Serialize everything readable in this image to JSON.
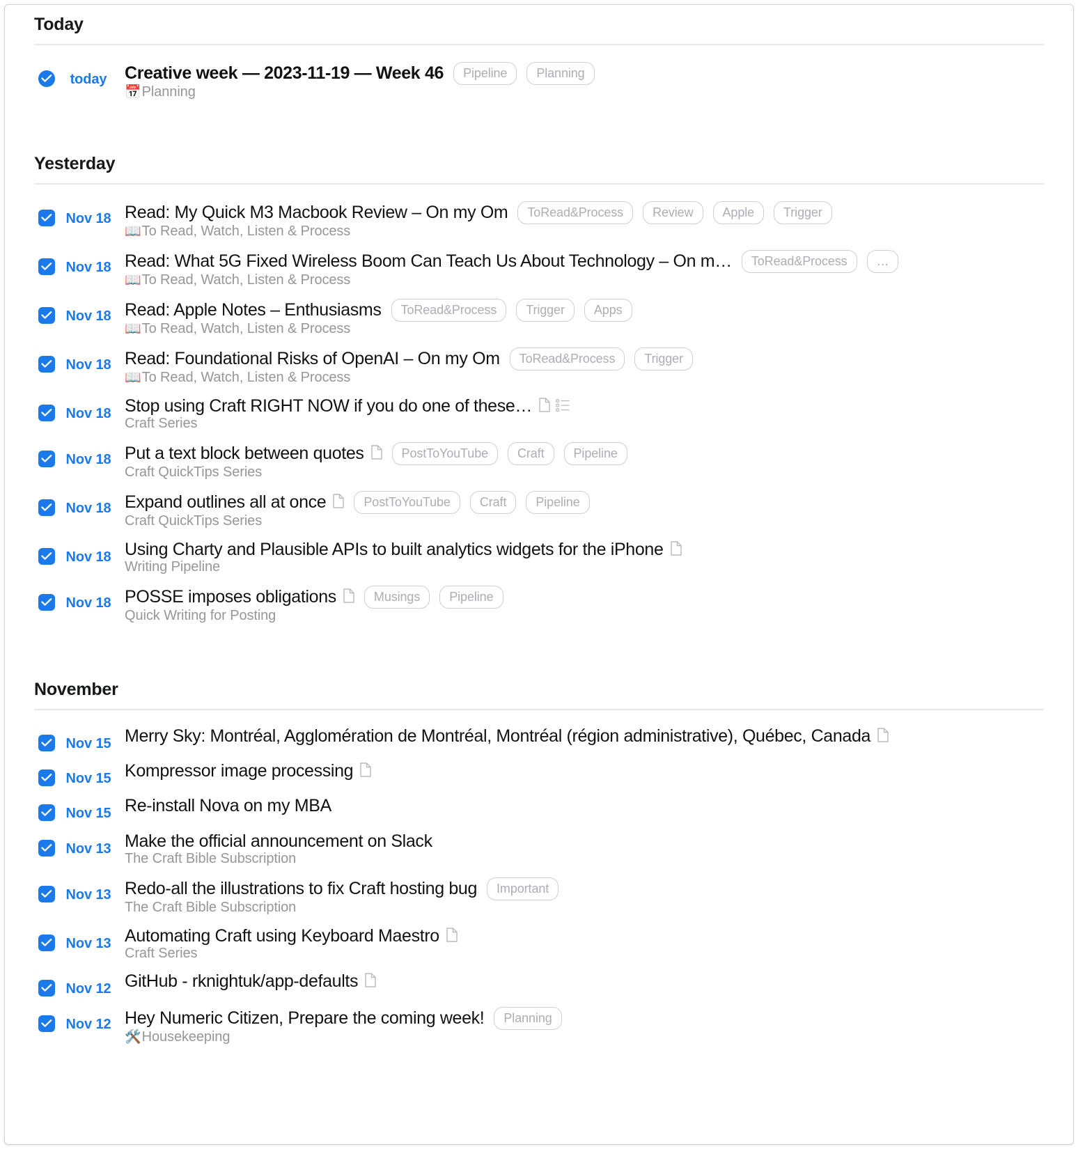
{
  "app": {
    "accent_color": "#1a7aeb",
    "tag_border_color": "#cfcfd6",
    "tag_text_color": "#adadb5",
    "muted_text_color": "#96969b",
    "title_text_color": "#121214"
  },
  "sections": [
    {
      "heading": "Today",
      "rows": [
        {
          "date": "today",
          "title": "Creative week — 2023-11-19 — Week 46",
          "title_bold": true,
          "icons": [],
          "tags": [
            "Pipeline",
            "Planning"
          ],
          "sub_emoji": "📅",
          "sub": "Planning"
        }
      ]
    },
    {
      "heading": "Yesterday",
      "rows": [
        {
          "date": "Nov 18",
          "title": "Read: My Quick M3 Macbook Review  – On my Om",
          "title_bold": false,
          "icons": [],
          "tags": [
            "ToRead&Process",
            "Review",
            "Apple",
            "Trigger"
          ],
          "sub_emoji": "📖",
          "sub": "To Read, Watch, Listen & Process"
        },
        {
          "date": "Nov 18",
          "title": "Read: What 5G Fixed Wireless Boom Can Teach Us About Technology – On m…",
          "title_bold": false,
          "icons": [],
          "tags": [
            "ToRead&Process",
            "…"
          ],
          "sub_emoji": "📖",
          "sub": "To Read, Watch, Listen & Process"
        },
        {
          "date": "Nov 18",
          "title": "Read: Apple Notes – Enthusiasms",
          "title_bold": false,
          "icons": [],
          "tags": [
            "ToRead&Process",
            "Trigger",
            "Apps"
          ],
          "sub_emoji": "📖",
          "sub": "To Read, Watch, Listen & Process"
        },
        {
          "date": "Nov 18",
          "title": "Read: Foundational Risks of OpenAI – On my Om",
          "title_bold": false,
          "icons": [],
          "tags": [
            "ToRead&Process",
            "Trigger"
          ],
          "sub_emoji": "📖",
          "sub": "To Read, Watch, Listen & Process"
        },
        {
          "date": "Nov 18",
          "title": "Stop using Craft RIGHT NOW if you do one of these…",
          "title_bold": false,
          "icons": [
            "document-icon",
            "checklist-icon"
          ],
          "tags": [],
          "sub_emoji": "",
          "sub": "Craft Series"
        },
        {
          "date": "Nov 18",
          "title": "Put a text block between quotes",
          "title_bold": false,
          "icons": [
            "document-icon"
          ],
          "tags": [
            "PostToYouTube",
            "Craft",
            "Pipeline"
          ],
          "sub_emoji": "",
          "sub": "Craft QuickTips Series"
        },
        {
          "date": "Nov 18",
          "title": "Expand outlines all at once",
          "title_bold": false,
          "icons": [
            "document-icon"
          ],
          "tags": [
            "PostToYouTube",
            "Craft",
            "Pipeline"
          ],
          "sub_emoji": "",
          "sub": "Craft QuickTips Series"
        },
        {
          "date": "Nov 18",
          "title": "Using Charty and Plausible APIs to built analytics widgets for the iPhone",
          "title_bold": false,
          "icons": [
            "document-icon"
          ],
          "tags": [],
          "sub_emoji": "",
          "sub": "Writing Pipeline"
        },
        {
          "date": "Nov 18",
          "title": "POSSE imposes obligations",
          "title_bold": false,
          "icons": [
            "document-icon"
          ],
          "tags": [
            "Musings",
            "Pipeline"
          ],
          "sub_emoji": "",
          "sub": "Quick Writing for Posting"
        }
      ]
    },
    {
      "heading": "November",
      "rows": [
        {
          "date": "Nov 15",
          "title": "Merry Sky: Montréal, Agglomération de Montréal, Montréal (région administrative), Québec, Canada",
          "title_bold": false,
          "icons": [
            "document-icon"
          ],
          "tags": [],
          "sub_emoji": "",
          "sub": ""
        },
        {
          "date": "Nov 15",
          "title": "Kompressor image processing",
          "title_bold": false,
          "icons": [
            "document-icon"
          ],
          "tags": [],
          "sub_emoji": "",
          "sub": ""
        },
        {
          "date": "Nov 15",
          "title": "Re-install Nova on my MBA",
          "title_bold": false,
          "icons": [],
          "tags": [],
          "sub_emoji": "",
          "sub": ""
        },
        {
          "date": "Nov 13",
          "title": "Make the official announcement on Slack",
          "title_bold": false,
          "icons": [],
          "tags": [],
          "sub_emoji": "",
          "sub": "The Craft Bible Subscription"
        },
        {
          "date": "Nov 13",
          "title": "Redo-all the illustrations to fix Craft hosting bug",
          "title_bold": false,
          "icons": [],
          "tags": [
            "Important"
          ],
          "sub_emoji": "",
          "sub": "The Craft Bible Subscription"
        },
        {
          "date": "Nov 13",
          "title": "Automating Craft using Keyboard Maestro",
          "title_bold": false,
          "icons": [
            "document-icon"
          ],
          "tags": [],
          "sub_emoji": "",
          "sub": "Craft Series"
        },
        {
          "date": "Nov 12",
          "title": "GitHub - rknightuk/app-defaults",
          "title_bold": false,
          "icons": [
            "document-icon"
          ],
          "tags": [],
          "sub_emoji": "",
          "sub": ""
        },
        {
          "date": "Nov 12",
          "title": "Hey Numeric Citizen, Prepare the coming week!",
          "title_bold": false,
          "icons": [],
          "tags": [
            "Planning"
          ],
          "sub_emoji": "🛠️",
          "sub": "Housekeeping"
        }
      ]
    }
  ]
}
